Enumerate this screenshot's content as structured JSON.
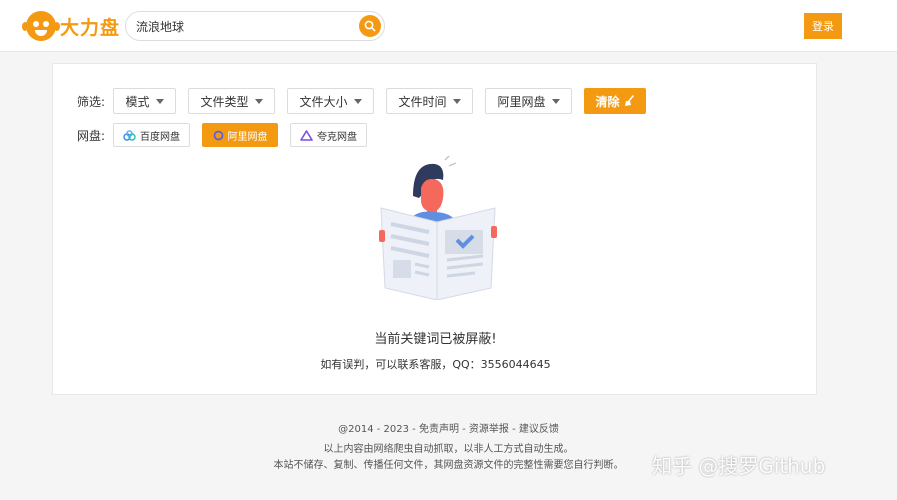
{
  "header": {
    "logo_text": "大力盘",
    "search_value": "流浪地球",
    "login_label": "登录"
  },
  "filters": {
    "label": "筛选:",
    "dropdowns": [
      "模式",
      "文件类型",
      "文件大小",
      "文件时间",
      "阿里网盘"
    ],
    "clear_label": "清除"
  },
  "disks": {
    "label": "网盘:",
    "items": [
      "百度网盘",
      "阿里网盘",
      "夸克网盘"
    ],
    "active": "阿里网盘"
  },
  "message": {
    "main": "当前关键词已被屏蔽!",
    "sub": "如有误判，可以联系客服，QQ：3556044645"
  },
  "footer": {
    "line1": "@2014 - 2023 - 免责声明 - 资源举报 - 建议反馈",
    "line2": "以上内容由网络爬虫自动抓取，以非人工方式自动生成。",
    "line3": "本站不储存、复制、传播任何文件，其网盘资源文件的完整性需要您自行判断。"
  },
  "watermark": "知乎 @搜罗Github",
  "colors": {
    "accent": "#f49a12"
  }
}
